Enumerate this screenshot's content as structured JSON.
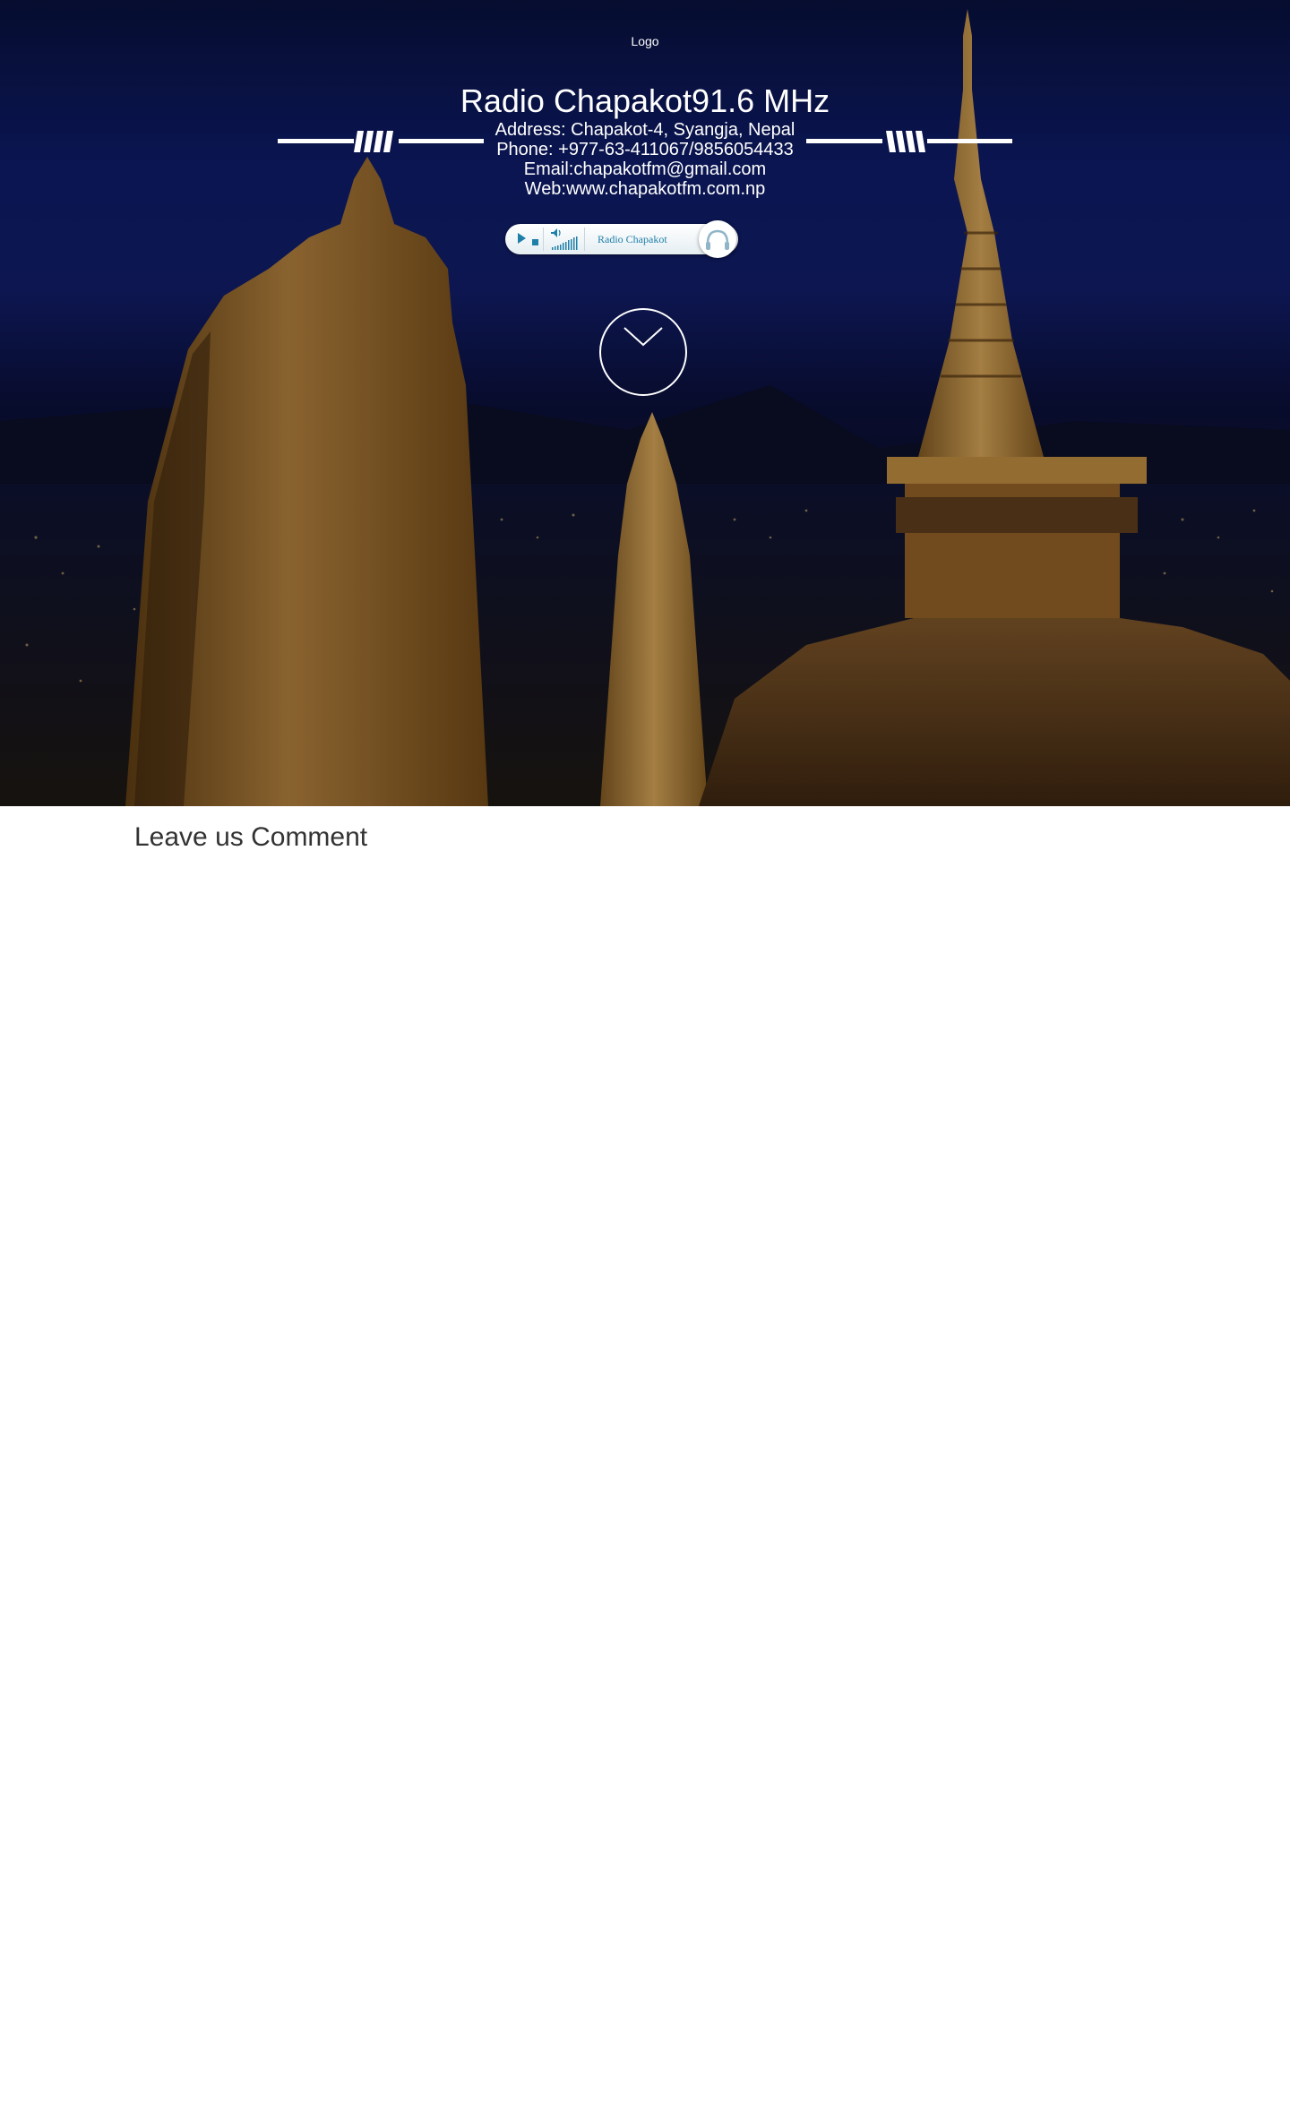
{
  "hero": {
    "logo_alt": "Logo",
    "title": "Radio Chapakot91.6 MHz",
    "address": "Address: Chapakot-4, Syangja, Nepal",
    "phone": "Phone: +977-63-411067/9856054433",
    "email": "Email:chapakotfm@gmail.com",
    "web": "Web:www.chapakotfm.com.np"
  },
  "player": {
    "station": "Radio Chapakot",
    "accent": "#1e7fa8",
    "icons": [
      "play-icon",
      "stop-icon",
      "volume-icon",
      "headphones-icon"
    ]
  },
  "scroll": {
    "icon": "chevron-down-icon"
  },
  "comments": {
    "heading": "Leave us Comment"
  }
}
